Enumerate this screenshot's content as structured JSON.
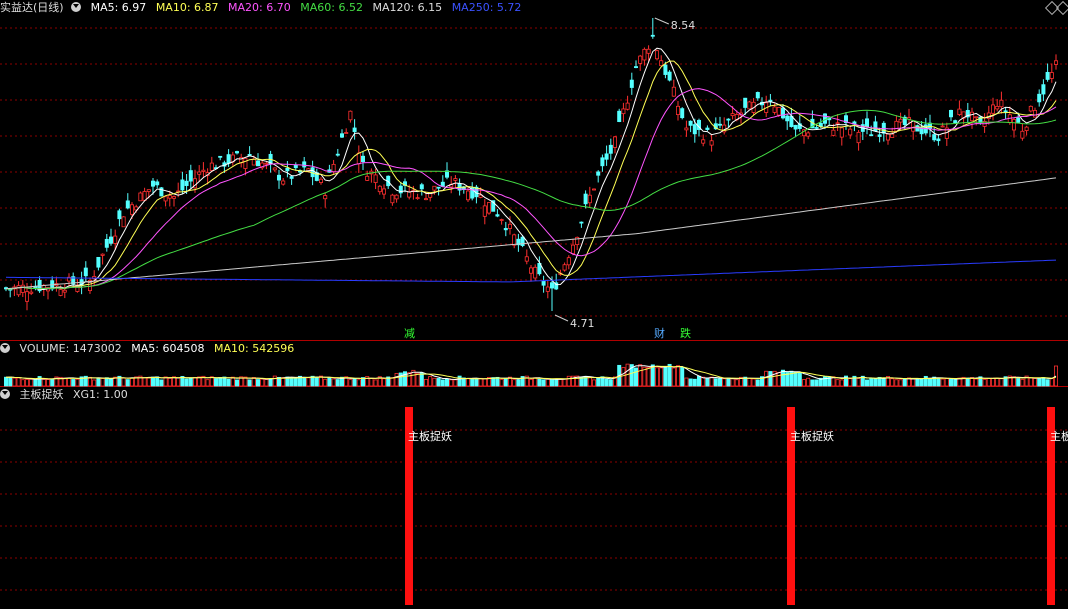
{
  "main": {
    "title": "实益达(日线)",
    "ma": [
      {
        "label": "MA5: 6.97",
        "color": "#ffffff"
      },
      {
        "label": "MA10: 6.87",
        "color": "#ffff55"
      },
      {
        "label": "MA20: 6.70",
        "color": "#ff55ff"
      },
      {
        "label": "MA60: 6.52",
        "color": "#44dd44"
      },
      {
        "label": "MA120: 6.15",
        "color": "#dddddd"
      },
      {
        "label": "MA250: 5.72",
        "color": "#3b52ff"
      }
    ],
    "high_label": "8.54",
    "low_label": "4.71",
    "event_labels": [
      {
        "text": "减",
        "color": "#33ff33"
      },
      {
        "text": "财",
        "color": "#55aaff"
      },
      {
        "text": "跌",
        "color": "#33ff33"
      }
    ]
  },
  "volume": {
    "label": "VOLUME: 1473002",
    "ma5": "MA5: 604508",
    "ma10": "MA10: 542596"
  },
  "indicator": {
    "title": "主板捉妖",
    "xg": "XG1: 1.00",
    "signal_labels": [
      "主板捉妖",
      "主板捉妖",
      "主板捉妖"
    ]
  },
  "chart_data": {
    "type": "candlestick",
    "price": {
      "high": 8.54,
      "low": 4.71,
      "last_MA5": 6.97,
      "last_MA10": 6.87,
      "last_MA20": 6.7,
      "last_MA60": 6.52,
      "last_MA120": 6.15,
      "last_MA250": 5.72
    },
    "volume": {
      "last": 1473002,
      "MA5": 604508,
      "MA10": 542596
    },
    "signal": {
      "name": "XG1",
      "value": 1.0
    }
  },
  "colors": {
    "up": "#ff3030",
    "down": "#54ffff",
    "grid": "#8b0000",
    "separator": "#b00000"
  }
}
